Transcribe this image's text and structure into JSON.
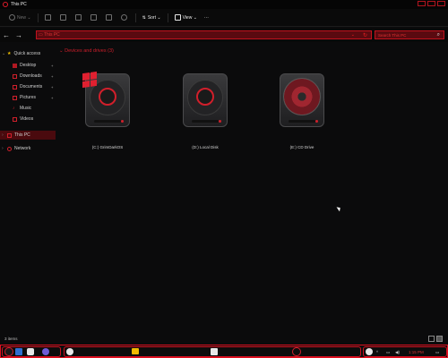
{
  "window": {
    "title": "This PC"
  },
  "toolbar": {
    "new_label": "New",
    "sort_label": "Sort",
    "view_label": "View",
    "more_label": "···"
  },
  "nav": {
    "back": "←",
    "forward": "→",
    "up": "↑"
  },
  "sidebar": {
    "items": [
      {
        "label": "Quick access",
        "icon": "star-icon"
      },
      {
        "label": "Desktop",
        "icon": "desktop-icon"
      },
      {
        "label": "Downloads",
        "icon": "download-icon"
      },
      {
        "label": "Documents",
        "icon": "document-icon"
      },
      {
        "label": "Pictures",
        "icon": "pictures-icon"
      },
      {
        "label": "Music",
        "icon": "music-icon"
      },
      {
        "label": "Videos",
        "icon": "videos-icon"
      },
      {
        "label": "This PC",
        "icon": "computer-icon"
      },
      {
        "label": "Network",
        "icon": "network-icon"
      }
    ]
  },
  "main": {
    "section_title": "Devices and drives (3)",
    "drives": [
      {
        "label": "(C:) GrimDarkOS",
        "icon": "system-drive-icon"
      },
      {
        "label": "(D:) Local Disk",
        "icon": "hard-drive-icon"
      },
      {
        "label": "(E:) CD Drive",
        "icon": "cd-drive-icon"
      }
    ]
  },
  "status": {
    "item_count": "3 items"
  },
  "taskbar": {
    "clock": "1:15 PM"
  },
  "colors": {
    "accent": "#d11f2b",
    "background": "#0b0b0c"
  }
}
